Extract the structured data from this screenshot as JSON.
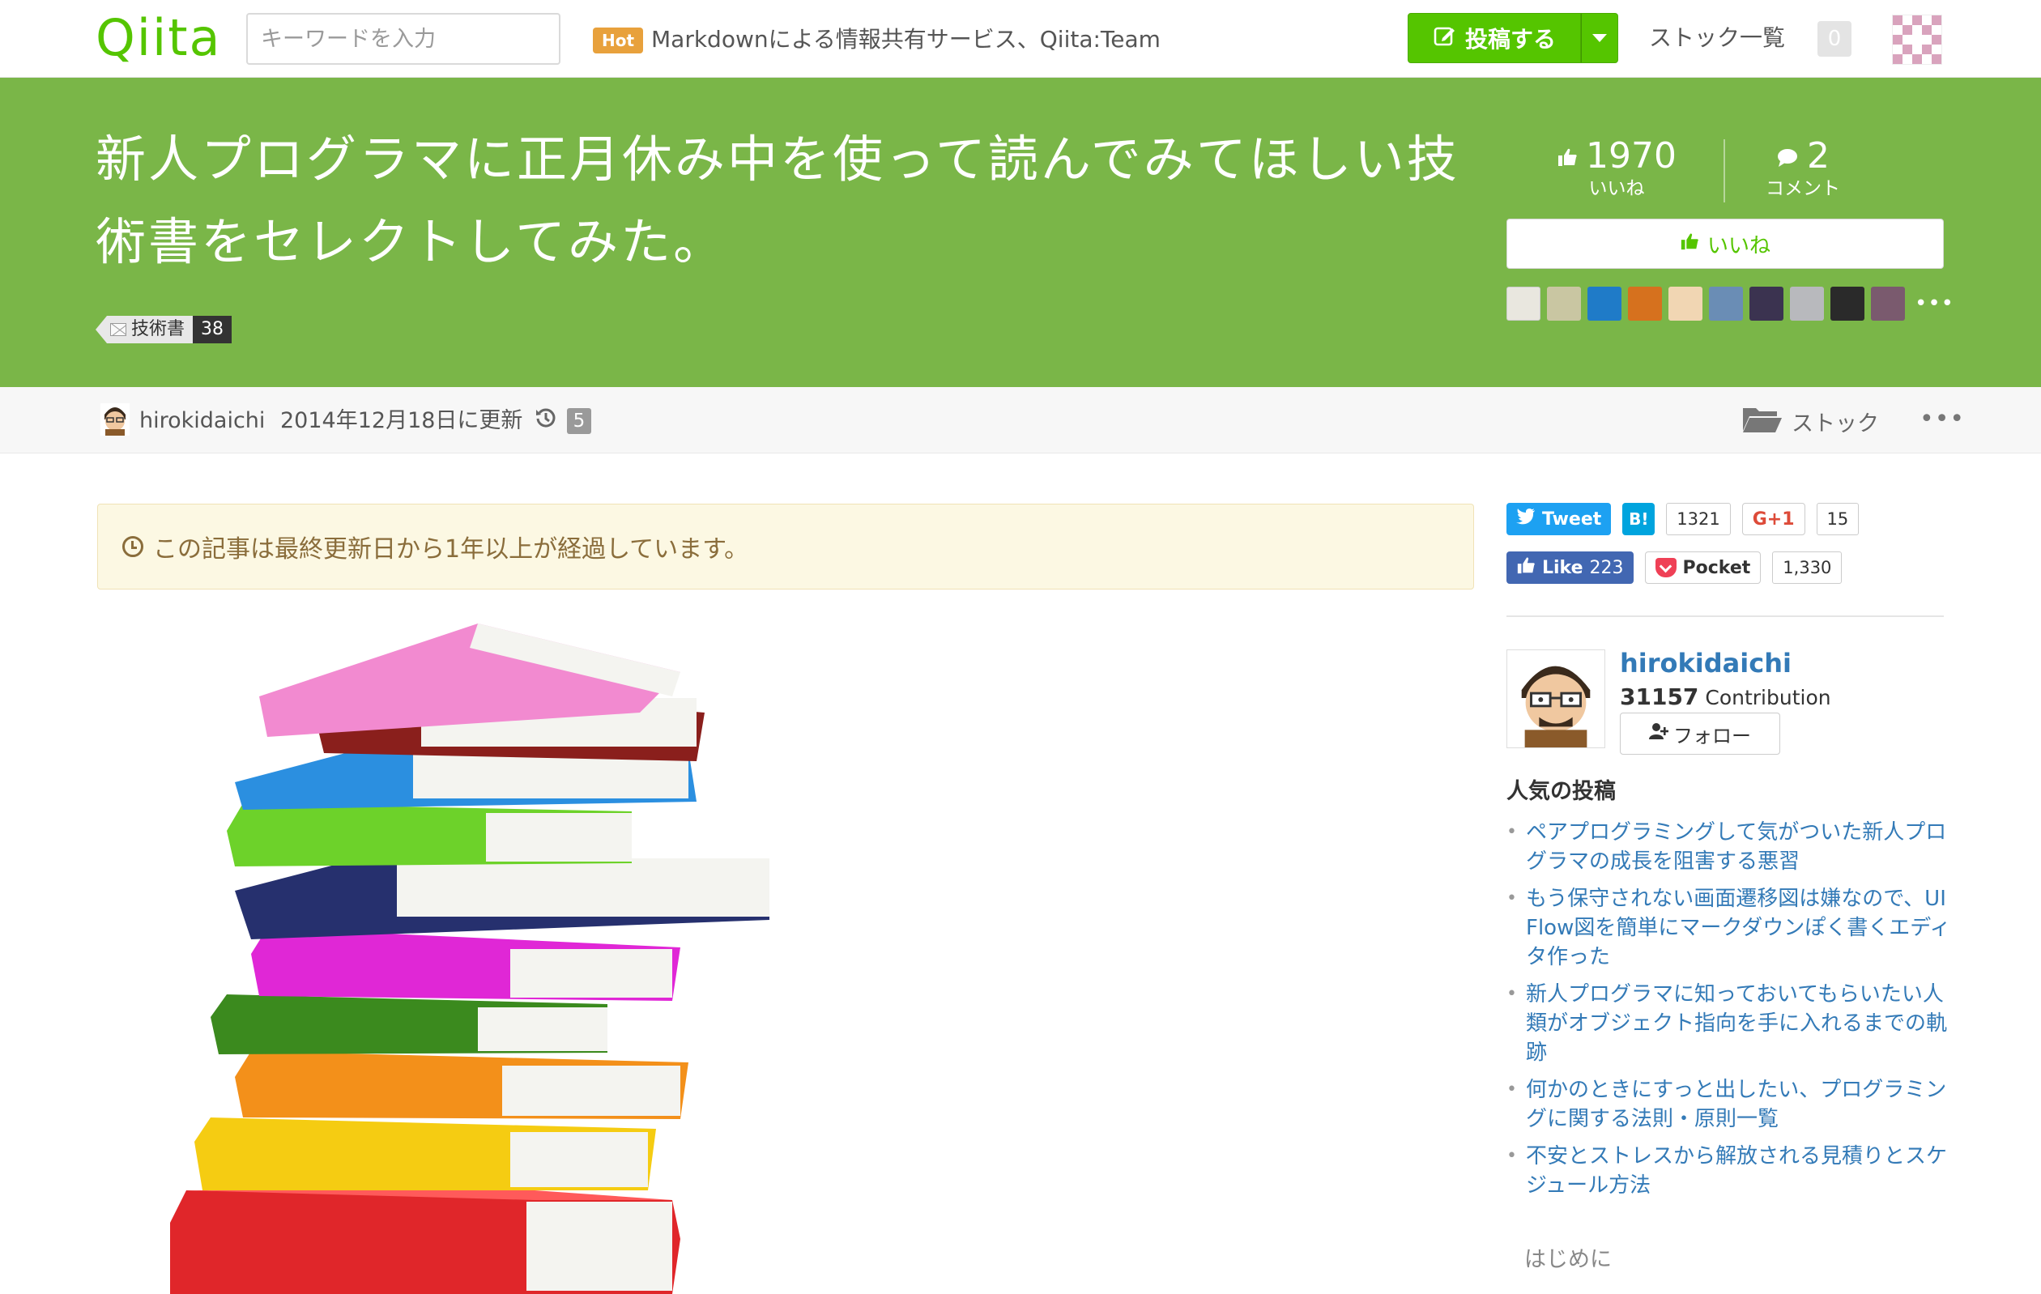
{
  "header": {
    "logo": "Qiita",
    "search_placeholder": "キーワードを入力",
    "hot_label": "Hot",
    "hot_text": "Markdownによる情報共有サービス、Qiita:Team",
    "post_button": "投稿する",
    "stock_list": "ストック一覧",
    "notification_count": "0"
  },
  "article": {
    "title": "新人プログラマに正月休み中を使って読んでみてほしい技術書をセレクトしてみた。",
    "tag": {
      "name": "技術書",
      "count": "38"
    },
    "likes_count": "1970",
    "likes_label": "いいね",
    "comments_count": "2",
    "comments_label": "コメント",
    "like_button": "いいね",
    "more_likers": "•••"
  },
  "meta": {
    "author": "hirokidaichi",
    "updated": "2014年12月18日に更新",
    "revisions": "5",
    "stock_button": "ストック",
    "more": "•••"
  },
  "notice": "この記事は最終更新日から1年以上が経過しています。",
  "social": {
    "tweet": "Tweet",
    "hatena": "B!",
    "hatena_count": "1321",
    "gplus": "G+1",
    "gplus_count": "15",
    "fb_like": "Like",
    "fb_count": "223",
    "pocket": "Pocket",
    "pocket_count": "1,330"
  },
  "sidebar": {
    "profile_name": "hirokidaichi",
    "contribution_count": "31157",
    "contribution_label": "Contribution",
    "follow_button": "フォロー",
    "popular_title": "人気の投稿",
    "popular_posts": [
      "ペアプログラミングして気がついた新人プログラマの成長を阻害する悪習",
      "もう保守されない画面遷移図は嫌なので、UI Flow図を簡単にマークダウンぽく書くエディタ作った",
      "新人プログラマに知っておいてもらいたい人類がオブジェクト指向を手に入れるまでの軌跡",
      "何かのときにすっと出したい、プログラミングに関する法則・原則一覧",
      "不安とストレスから解放される見積りとスケジュール方法"
    ],
    "toc_first": "はじめに"
  },
  "colors": {
    "brand_green": "#55c500",
    "hero_green": "#7ab648",
    "link_blue": "#337ab7",
    "notice_bg": "#fcf8e3",
    "hot_orange": "#e8a13c"
  }
}
